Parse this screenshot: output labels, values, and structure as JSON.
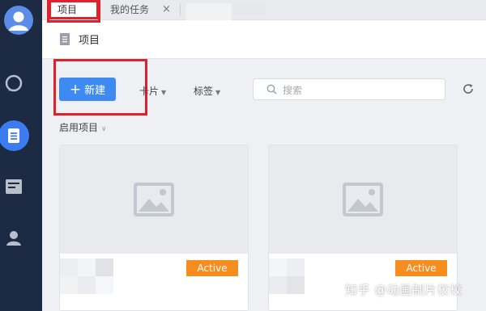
{
  "tabs": [
    {
      "label": "项目",
      "active": true
    },
    {
      "label": "我的任务",
      "active": false
    }
  ],
  "tab_close_glyph": "×",
  "breadcrumb": {
    "title": "项目",
    "icon": "document-icon"
  },
  "toolbar": {
    "new_label": "新建",
    "card_label": "卡片",
    "tag_label": "标签",
    "search_placeholder": "搜索"
  },
  "section": {
    "label": "启用项目"
  },
  "cards": [
    {
      "status": "Active"
    },
    {
      "status": "Active"
    }
  ],
  "watermark": "知乎 @动画制片校校",
  "colors": {
    "rail": "#1d2a44",
    "accent": "#3d8bf2",
    "status_active": "#f78c1f",
    "annotation": "#e0202a"
  },
  "rail_icons": [
    "avatar",
    "chat-icon",
    "document-icon",
    "inbox-icon",
    "user-icon"
  ]
}
